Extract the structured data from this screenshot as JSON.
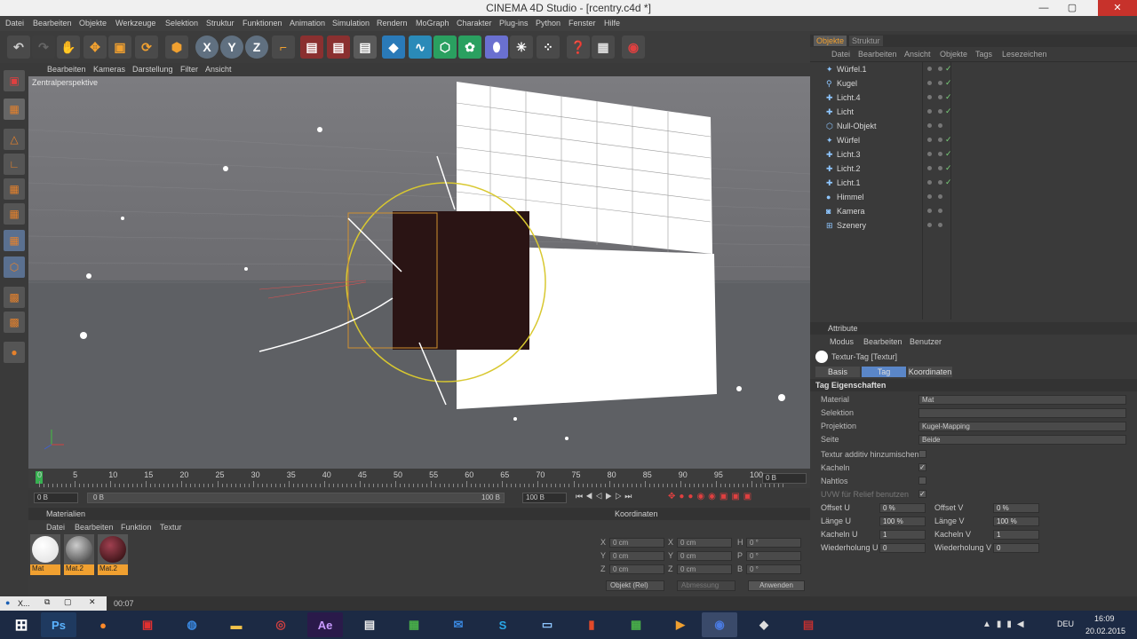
{
  "window": {
    "title": "CINEMA 4D Studio - [rcentry.c4d *]"
  },
  "menubar": [
    "Datei",
    "Bearbeiten",
    "Objekte",
    "Werkzeuge",
    "Selektion",
    "Struktur",
    "Funktionen",
    "Animation",
    "Simulation",
    "Rendern",
    "MoGraph",
    "Charakter",
    "Plug-ins",
    "Python",
    "Fenster",
    "Hilfe"
  ],
  "viewport": {
    "menu": [
      "Bearbeiten",
      "Kameras",
      "Darstellung",
      "Filter",
      "Ansicht"
    ],
    "label": "Zentralperspektive"
  },
  "timeline": {
    "ticks": [
      "0",
      "5",
      "10",
      "15",
      "20",
      "25",
      "30",
      "35",
      "40",
      "45",
      "50",
      "55",
      "60",
      "65",
      "70",
      "75",
      "80",
      "85",
      "90",
      "95",
      "100"
    ],
    "frame_end_box": "0 B",
    "start_field": "0 B",
    "current_field": "0 B",
    "end_range": "100 B",
    "end_field": "100 B"
  },
  "materials": {
    "title": "Materialien",
    "menu": [
      "Datei",
      "Bearbeiten",
      "Funktion",
      "Textur"
    ],
    "items": [
      {
        "name": "Mat"
      },
      {
        "name": "Mat.2"
      },
      {
        "name": "Mat.2"
      }
    ]
  },
  "coordinates": {
    "title": "Koordinaten",
    "rows": [
      {
        "a": "X",
        "av": "0 cm",
        "b": "X",
        "bv": "0 cm",
        "c": "H",
        "cv": "0 °"
      },
      {
        "a": "Y",
        "av": "0 cm",
        "b": "Y",
        "bv": "0 cm",
        "c": "P",
        "cv": "0 °"
      },
      {
        "a": "Z",
        "av": "0 cm",
        "b": "Z",
        "bv": "0 cm",
        "c": "B",
        "cv": "0 °"
      }
    ],
    "mode": "Objekt (Rel)",
    "size_mode": "Abmessung",
    "apply": "Anwenden"
  },
  "objects": {
    "tabs": [
      "Objekte",
      "Struktur"
    ],
    "menu": [
      "Datei",
      "Bearbeiten",
      "Ansicht",
      "Objekte",
      "Tags",
      "Lesezeichen"
    ],
    "items": [
      "Würfel.1",
      "Kugel",
      "Licht.4",
      "Licht",
      "Null-Objekt",
      "Würfel",
      "Licht.3",
      "Licht.2",
      "Licht.1",
      "Himmel",
      "Kamera",
      "Szenery"
    ]
  },
  "attributes": {
    "title": "Attribute",
    "menu": [
      "Modus",
      "Bearbeiten",
      "Benutzer"
    ],
    "tag_name": "Textur-Tag [Textur]",
    "tabs": [
      "Basis",
      "Tag",
      "Koordinaten"
    ],
    "section": "Tag Eigenschaften",
    "fields": [
      {
        "label": "Material",
        "value": "Mat"
      },
      {
        "label": "Selektion",
        "value": ""
      },
      {
        "label": "Projektion",
        "value": "Kugel-Mapping"
      },
      {
        "label": "Seite",
        "value": "Beide"
      }
    ],
    "checks": [
      {
        "label": "Textur additiv hinzumischen",
        "checked": false
      },
      {
        "label": "Kacheln",
        "checked": true
      },
      {
        "label": "Nahtlos",
        "checked": false
      },
      {
        "label": "UVW für Relief benutzen",
        "checked": true
      }
    ],
    "numbers": [
      {
        "l1": "Offset U",
        "v1": "0 %",
        "l2": "Offset V",
        "v2": "0 %"
      },
      {
        "l1": "Länge U",
        "v1": "100 %",
        "l2": "Länge V",
        "v2": "100 %"
      },
      {
        "l1": "Kacheln U",
        "v1": "1",
        "l2": "Kacheln V",
        "v2": "1"
      },
      {
        "l1": "Wiederholung U",
        "v1": "0",
        "l2": "Wiederholung V",
        "v2": "0"
      }
    ]
  },
  "status": {
    "time": "00:07",
    "task_label": "X..."
  },
  "taskbar": {
    "lang": "DEU",
    "clock": "16:09",
    "date": "20.02.2015"
  }
}
